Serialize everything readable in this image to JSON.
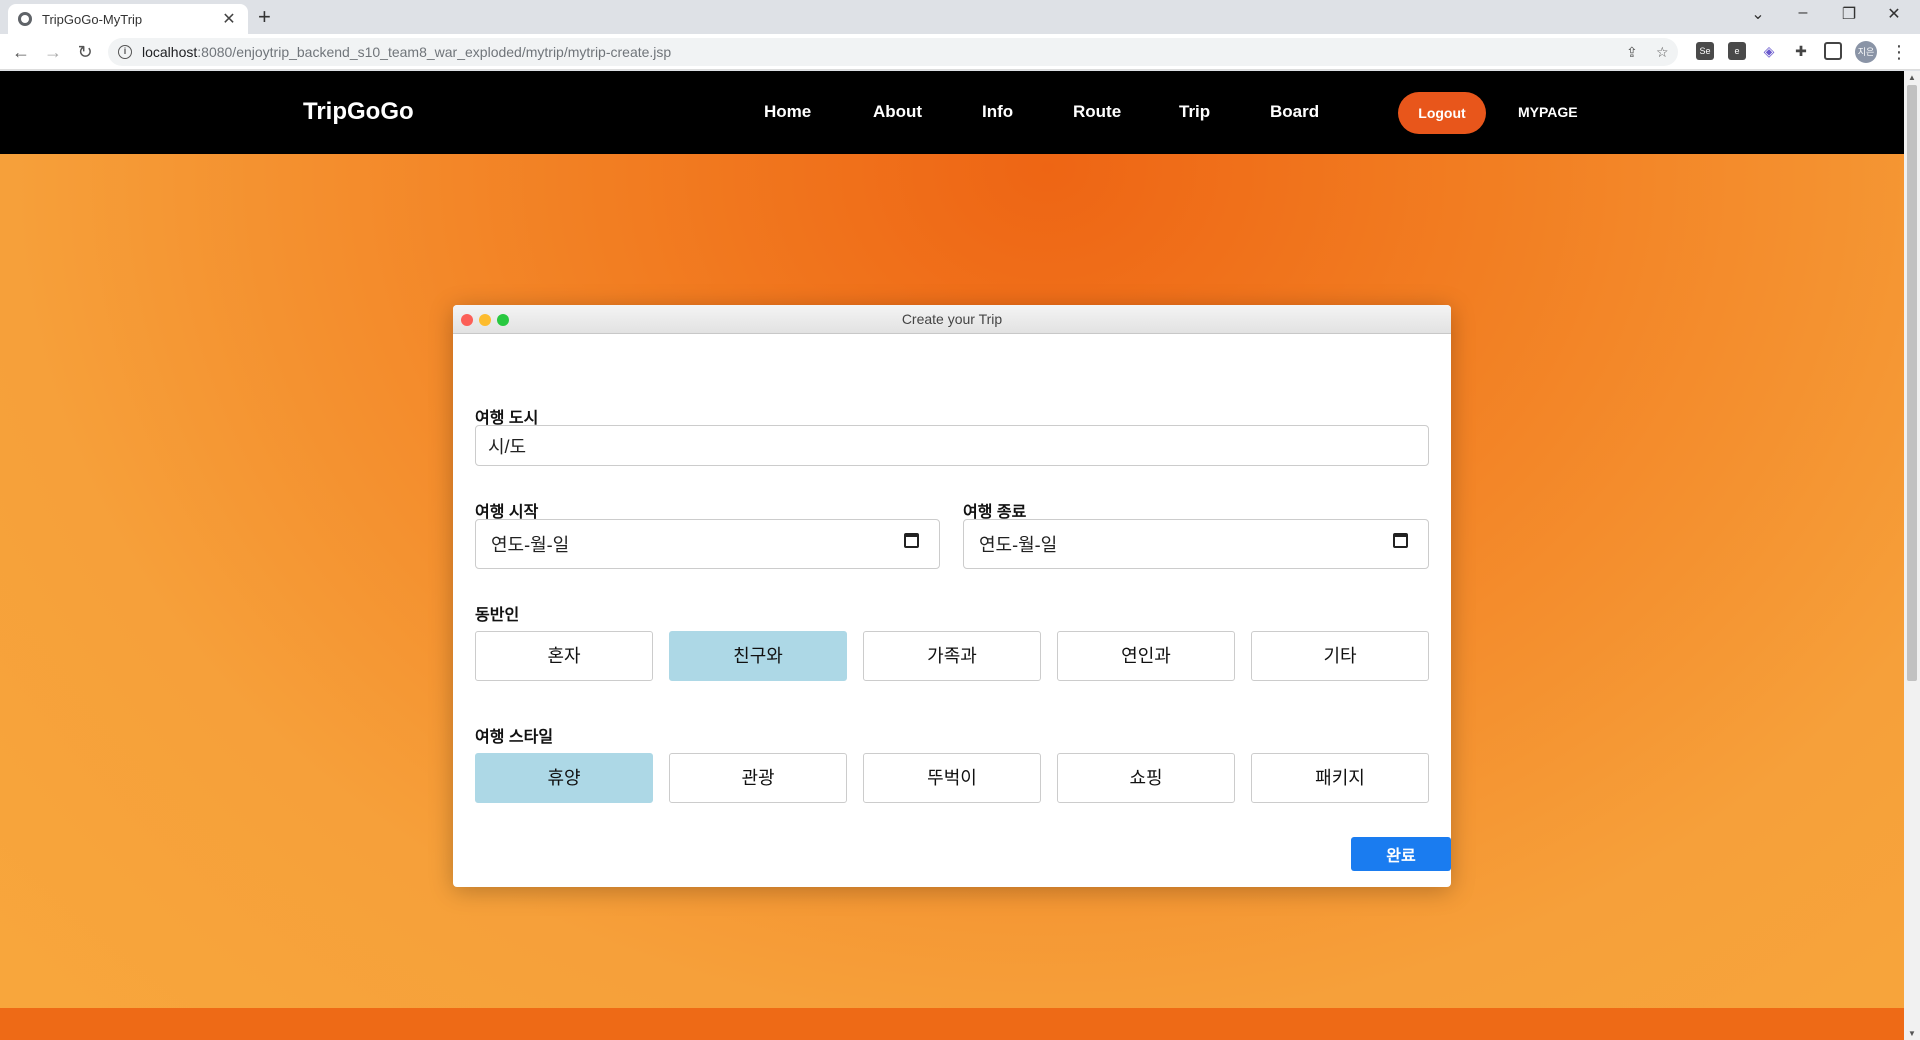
{
  "browser": {
    "tab_title": "TripGoGo-MyTrip",
    "tab_close": "✕",
    "new_tab": "+",
    "url_host": "localhost",
    "url_path": ":8080/enjoytrip_backend_s10_team8_war_exploded/mytrip/mytrip-create.jsp",
    "profile_initials": "지은"
  },
  "site": {
    "brand": "TripGoGo",
    "nav": [
      "Home",
      "About",
      "Info",
      "Route",
      "Trip",
      "Board"
    ],
    "logout": "Logout",
    "mypage": "MYPAGE"
  },
  "modal": {
    "title": "Create your Trip",
    "city_label": "여행 도시",
    "city_value": "시/도",
    "start_label": "여행 시작",
    "start_placeholder": "연도-월-일",
    "end_label": "여행 종료",
    "end_placeholder": "연도-월-일",
    "companion_label": "동반인",
    "companions": [
      "혼자",
      "친구와",
      "가족과",
      "연인과",
      "기타"
    ],
    "companion_selected": "친구와",
    "style_label": "여행 스타일",
    "styles": [
      "휴양",
      "관광",
      "뚜벅이",
      "쇼핑",
      "패키지"
    ],
    "style_selected": "휴양",
    "submit": "완료"
  },
  "colors": {
    "accent": "#e8561b",
    "selected": "#add8e6",
    "primary_button": "#1a7cf0"
  }
}
